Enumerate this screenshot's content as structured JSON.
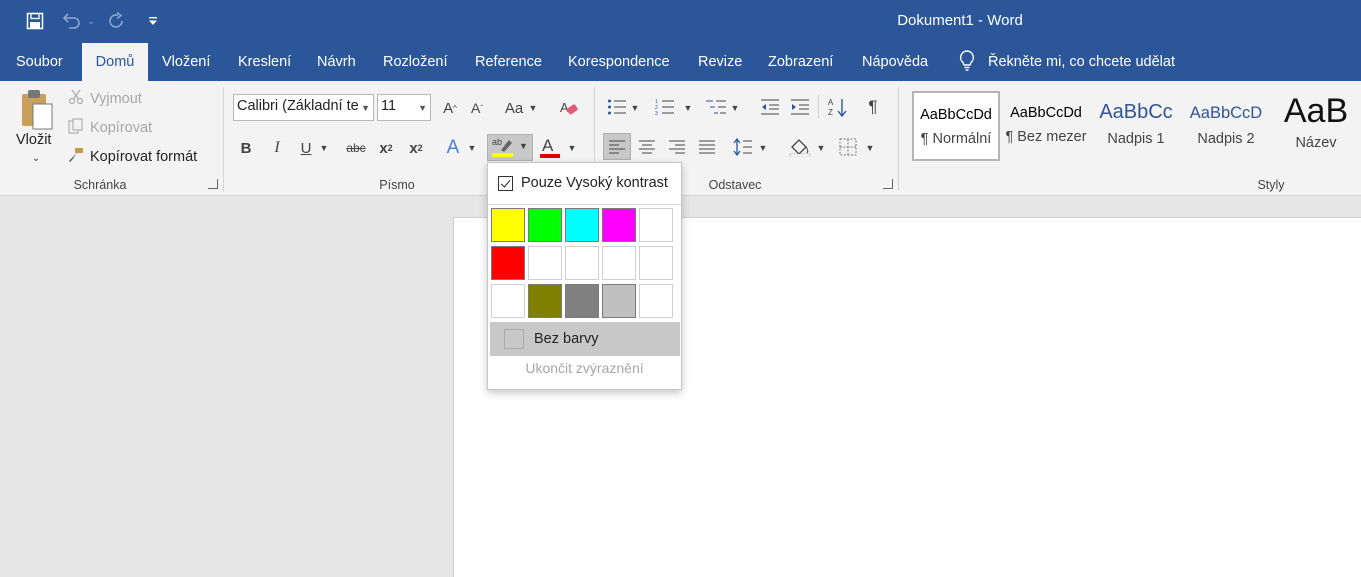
{
  "window": {
    "title": "Dokument1  -  Word"
  },
  "tabs": [
    {
      "label": "Soubor"
    },
    {
      "label": "Domů"
    },
    {
      "label": "Vložení"
    },
    {
      "label": "Kreslení"
    },
    {
      "label": "Návrh"
    },
    {
      "label": "Rozložení"
    },
    {
      "label": "Reference"
    },
    {
      "label": "Korespondence"
    },
    {
      "label": "Revize"
    },
    {
      "label": "Zobrazení"
    },
    {
      "label": "Nápověda"
    }
  ],
  "active_tab": "Domů",
  "tellme": {
    "label": "Řekněte mi, co chcete udělat"
  },
  "clipboard": {
    "paste": "Vložit",
    "cut": "Vyjmout",
    "copy": "Kopírovat",
    "format_painter": "Kopírovat formát",
    "group_label": "Schránka"
  },
  "font": {
    "name": "Calibri (Základní te",
    "size": "11",
    "group_label": "Písmo",
    "change_case": "Aa"
  },
  "paragraph": {
    "group_label": "Odstavec"
  },
  "styles": {
    "group_label": "Styly",
    "items": [
      {
        "sample": "AaBbCcDd",
        "name": "¶ Normální"
      },
      {
        "sample": "AaBbCcDd",
        "name": "¶ Bez mezer"
      },
      {
        "sample": "AaBbCc",
        "name": "Nadpis 1"
      },
      {
        "sample": "AaBbCcD",
        "name": "Nadpis 2"
      },
      {
        "sample": "AaB",
        "name": "Název"
      }
    ]
  },
  "highlight_popup": {
    "high_contrast_label": "Pouze Vysoký kontrast",
    "high_contrast_checked": true,
    "colors": [
      [
        "#ffff00",
        "#00ff00",
        "#00ffff",
        "#ff00ff",
        "#ffffff"
      ],
      [
        "#ff0000",
        "#ffffff",
        "#ffffff",
        "#ffffff",
        "#ffffff"
      ],
      [
        "#ffffff",
        "#808000",
        "#808080",
        "#c0c0c0",
        "#ffffff"
      ]
    ],
    "no_color_label": "Bez barvy",
    "stop_label": "Ukončit zvýraznění"
  },
  "colors": {
    "accent": "#2b579a",
    "font_color_bar": "#e00000",
    "highlight_bar": "#ffff00"
  }
}
